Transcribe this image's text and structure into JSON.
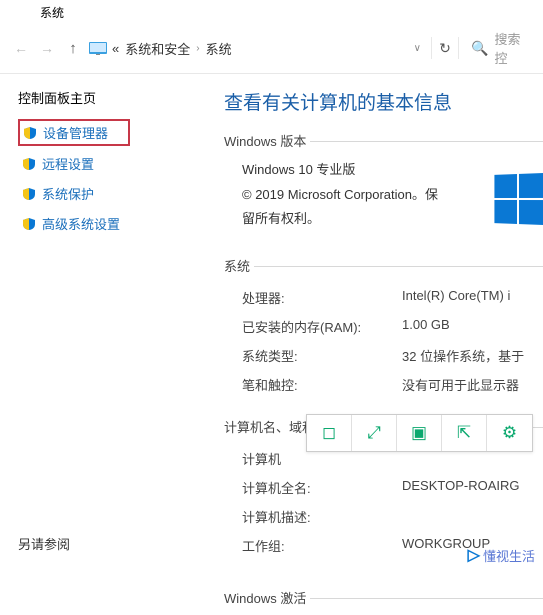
{
  "window": {
    "title": "系统"
  },
  "nav": {
    "crumb1_prefix": "«",
    "crumb1": "系统和安全",
    "crumb2": "系统",
    "search_placeholder": "搜索控"
  },
  "sidebar": {
    "heading": "控制面板主页",
    "items": [
      {
        "label": "设备管理器"
      },
      {
        "label": "远程设置"
      },
      {
        "label": "系统保护"
      },
      {
        "label": "高级系统设置"
      }
    ],
    "see_also": "另请参阅"
  },
  "content": {
    "page_title": "查看有关计算机的基本信息",
    "edition": {
      "section": "Windows 版本",
      "name": "Windows 10 专业版",
      "copyright": "© 2019 Microsoft Corporation。保留所有权利。"
    },
    "system": {
      "section": "系统",
      "rows": [
        {
          "label": "处理器:",
          "value": "Intel(R) Core(TM) i"
        },
        {
          "label": "已安装的内存(RAM):",
          "value": "1.00 GB"
        },
        {
          "label": "系统类型:",
          "value": "32 位操作系统，基于"
        },
        {
          "label": "笔和触控:",
          "value": "没有可用于此显示器"
        }
      ]
    },
    "computer": {
      "section": "计算机名、域和工作组设置",
      "rows": [
        {
          "label": "计算机",
          "value": ""
        },
        {
          "label": "计算机全名:",
          "value": "DESKTOP-ROAIRG"
        },
        {
          "label": "计算机描述:",
          "value": ""
        },
        {
          "label": "工作组:",
          "value": "WORKGROUP"
        }
      ]
    },
    "activation": {
      "section": "Windows 激活"
    }
  },
  "watermark": {
    "text": "懂视生活"
  }
}
